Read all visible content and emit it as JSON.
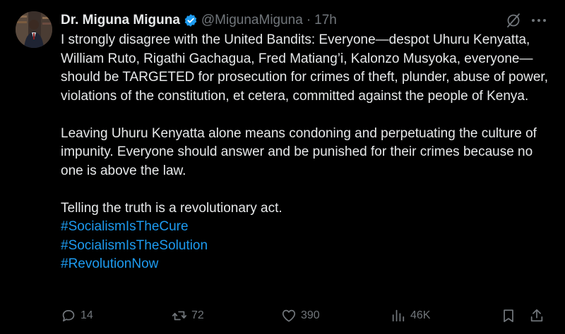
{
  "author": {
    "display_name": "Dr. Miguna Miguna",
    "handle": "@MigunaMiguna",
    "separator": "·",
    "time": "17h"
  },
  "tweet": {
    "paragraph_1": "I strongly disagree with the United Bandits: Everyone—despot Uhuru Kenyatta, William Ruto, Rigathi Gachagua, Fred Matiang’i, Kalonzo Musyoka, everyone—should be TARGETED for prosecution for crimes of theft, plunder, abuse of power, violations of the constitution, et cetera, committed against the people of Kenya.",
    "paragraph_2": "Leaving Uhuru Kenyatta alone means condoning and perpetuating the culture of impunity. Everyone should answer and be punished for their crimes because no one is above the law.",
    "paragraph_3": "Telling the truth is a revolutionary act.",
    "hashtags": [
      "#SocialismIsTheCure",
      "#SocialismIsTheSolution",
      "#RevolutionNow"
    ]
  },
  "metrics": {
    "replies": "14",
    "reposts": "72",
    "likes": "390",
    "views": "46K"
  },
  "icons": {
    "verified": "verified-badge-icon",
    "grok": "grok-icon",
    "more": "more-icon",
    "reply": "reply-icon",
    "repost": "repost-icon",
    "like": "heart-icon",
    "views": "views-icon",
    "bookmark": "bookmark-icon",
    "share": "share-icon"
  },
  "colors": {
    "background": "#000000",
    "text": "#e7e9ea",
    "muted": "#71767b",
    "link": "#1d9bf0",
    "verified": "#1d9bf0"
  }
}
